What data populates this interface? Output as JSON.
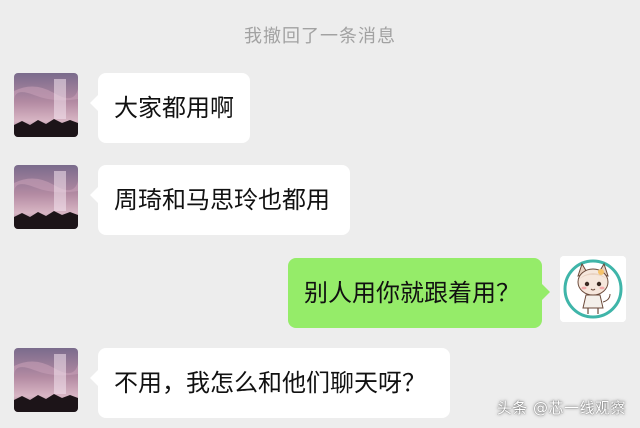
{
  "system_notice": "我撤回了一条消息",
  "messages": [
    {
      "from": "other",
      "text": "大家都用啊"
    },
    {
      "from": "other",
      "text": "周琦和马思玲也都用"
    },
    {
      "from": "self",
      "text": "别人用你就跟着用？"
    },
    {
      "from": "other",
      "text": "不用，我怎么和他们聊天呀？"
    }
  ],
  "avatars": {
    "other": {
      "icon": "sunset-sky-avatar"
    },
    "self": {
      "icon": "cat-girl-avatar"
    }
  },
  "watermark": "头条 @芯一线观察",
  "colors": {
    "background": "#ededed",
    "incoming_bubble": "#ffffff",
    "outgoing_bubble": "#95ec69",
    "system_text": "#a2a2a2",
    "avatar_ring": "#3fb5a9"
  }
}
